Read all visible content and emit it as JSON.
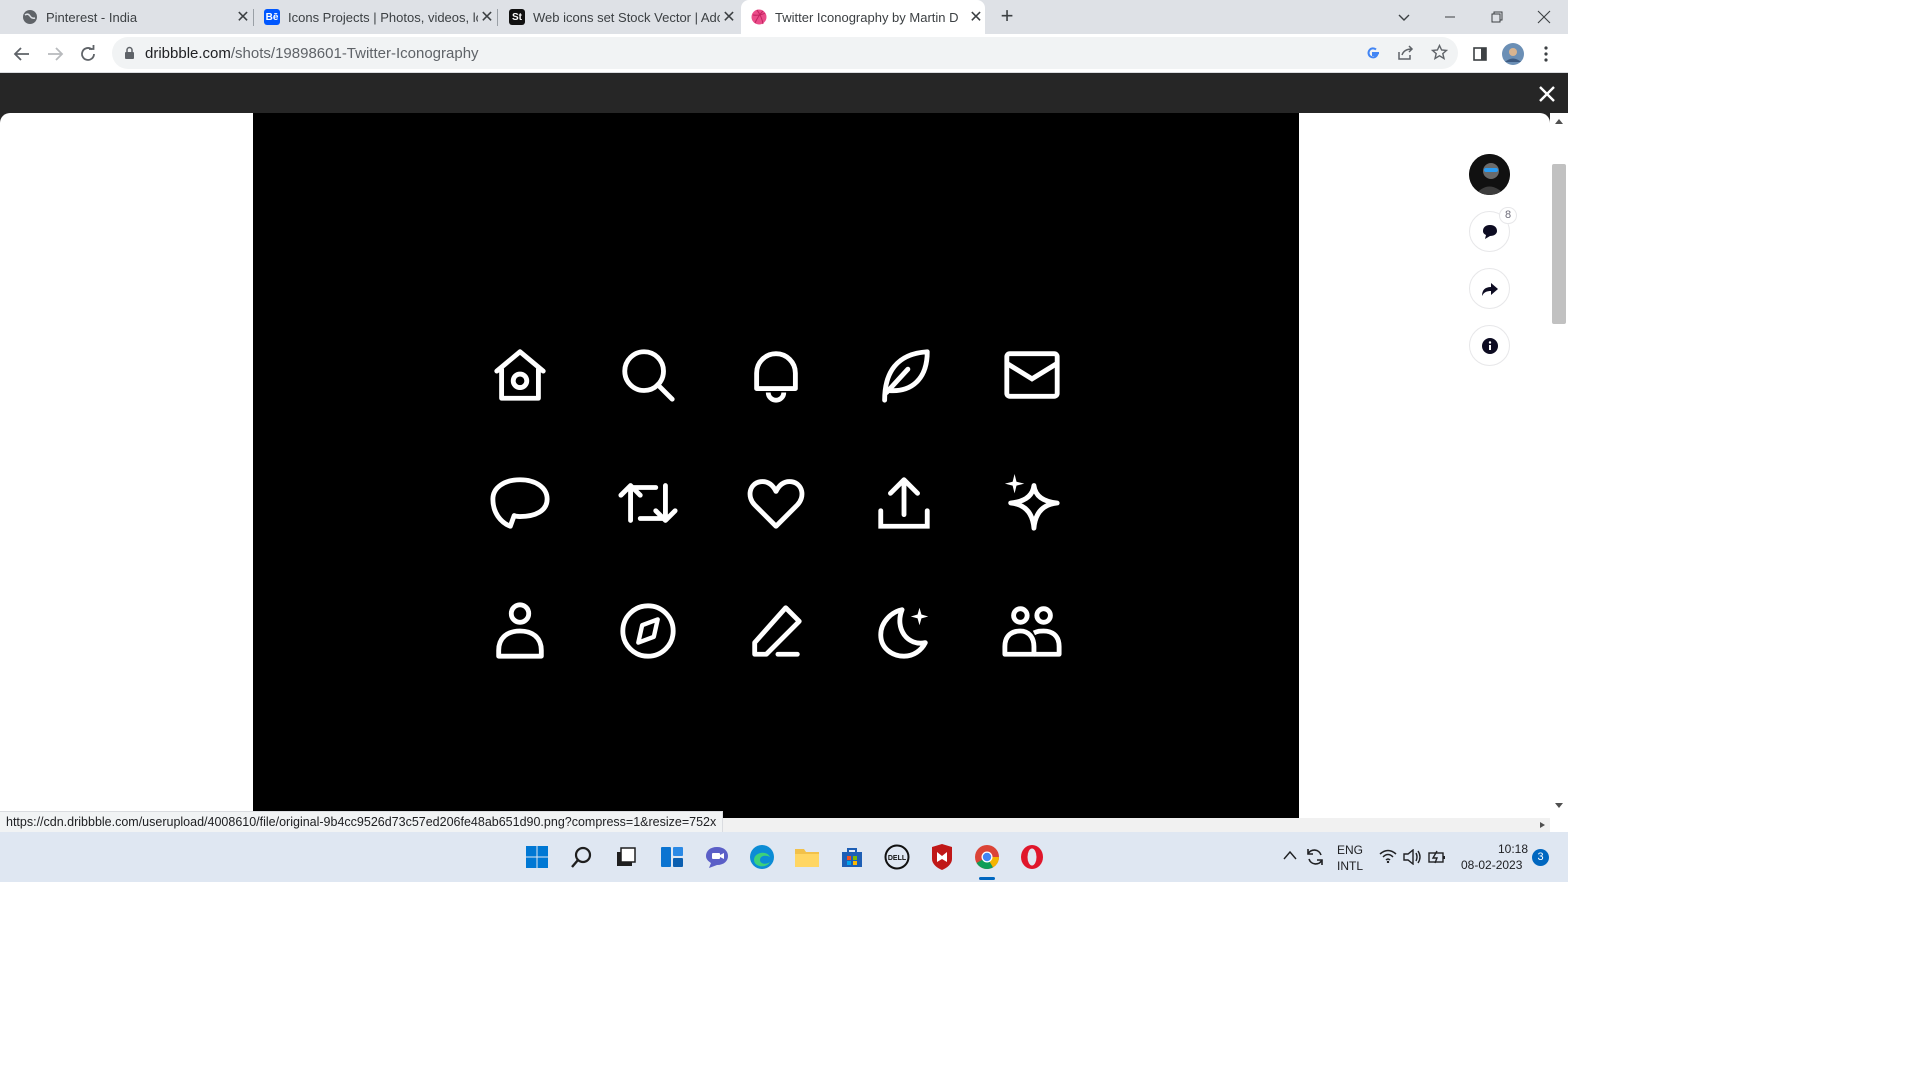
{
  "browser": {
    "tabs": [
      {
        "label": "Pinterest - India",
        "fav": "globe-icon",
        "fav_text": ""
      },
      {
        "label": "Icons Projects | Photos, videos, lo",
        "fav": "behance-icon",
        "fav_text": "Bē"
      },
      {
        "label": "Web icons set Stock Vector | Ado",
        "fav": "adobe-stock-icon",
        "fav_text": "St"
      },
      {
        "label": "Twitter Iconography by Martin D",
        "fav": "dribbble-icon",
        "fav_text": ""
      }
    ],
    "url_host": "dribbble.com",
    "url_path": "/shots/19898601-Twitter-Iconography"
  },
  "shot": {
    "icons": [
      "home-icon",
      "search-icon",
      "bell-icon",
      "feather-icon",
      "mail-icon",
      "chat-bubble-icon",
      "retweet-icon",
      "heart-icon",
      "share-icon",
      "sparkle-icon",
      "person-icon",
      "compass-icon",
      "edit-icon",
      "moon-star-icon",
      "people-icon"
    ],
    "comment_count": "8"
  },
  "status": {
    "hover_url": "https://cdn.dribbble.com/userupload/4008610/file/original-9b4cc9526d73c57ed206fe48ab651d90.png?compress=1&resize=752x"
  },
  "taskbar": {
    "lang1": "ENG",
    "lang2": "INTL",
    "time": "10:18",
    "date": "08-02-2023",
    "notif_count": "3"
  },
  "colors": {
    "accent": "#ea4c89",
    "behance": "#0057ff",
    "taskbar": "#dfe7f2"
  }
}
